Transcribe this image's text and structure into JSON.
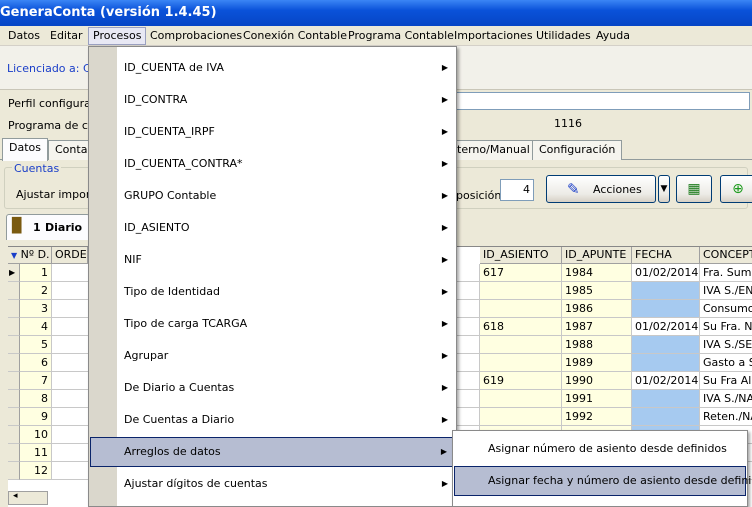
{
  "app": {
    "title": "GeneraConta (versión 1.4.45)"
  },
  "menubar": [
    "Datos",
    "Editar",
    "Procesos",
    "Comprobaciones",
    "Conexión Contable",
    "Programa Contable",
    "Importaciones",
    "Utilidades",
    "Ayuda"
  ],
  "license_text": "Licenciado a: CR",
  "form": {
    "perfil_label": "Perfil configurac",
    "programa_label": "Programa de cor",
    "value_1116": "1116"
  },
  "tabs": [
    "Datos",
    "Conta",
    "terno/Manual",
    "Configuración"
  ],
  "cuentas": {
    "group_label": "Cuentas",
    "ajustar_label": "Ajustar importa",
    "posicion_label": "posición",
    "posicion_value": "4",
    "acciones_label": "Acciones"
  },
  "diario_tab": {
    "num": "1",
    "label": "Diario"
  },
  "grid": {
    "columns": [
      "Nº D.",
      "ORDE",
      "ID_ASIENTO",
      "ID_APUNTE",
      "FECHA",
      "CONCEPT"
    ],
    "rows": [
      {
        "n": "1",
        "asiento": "617",
        "apunte": "1984",
        "fecha": "01/02/2014",
        "concepto": "Fra. Sumir"
      },
      {
        "n": "2",
        "asiento": "",
        "apunte": "1985",
        "fecha": "",
        "concepto": "IVA S./EN"
      },
      {
        "n": "3",
        "asiento": "",
        "apunte": "1986",
        "fecha": "",
        "concepto": "Consumo"
      },
      {
        "n": "4",
        "asiento": "618",
        "apunte": "1987",
        "fecha": "01/02/2014",
        "concepto": "Su Fra. Nº"
      },
      {
        "n": "5",
        "asiento": "",
        "apunte": "1988",
        "fecha": "",
        "concepto": "IVA S./SE"
      },
      {
        "n": "6",
        "asiento": "",
        "apunte": "1989",
        "fecha": "",
        "concepto": "Gasto a S"
      },
      {
        "n": "7",
        "asiento": "619",
        "apunte": "1990",
        "fecha": "01/02/2014",
        "concepto": "Su Fra Alc"
      },
      {
        "n": "8",
        "asiento": "",
        "apunte": "1991",
        "fecha": "",
        "concepto": "IVA S./NA"
      },
      {
        "n": "9",
        "asiento": "",
        "apunte": "1992",
        "fecha": "",
        "concepto": "Reten./NA"
      },
      {
        "n": "10",
        "asiento": "",
        "apunte": "",
        "fecha": "",
        "concepto": ""
      },
      {
        "n": "11",
        "asiento": "",
        "apunte": "",
        "fecha": "",
        "concepto": ""
      },
      {
        "n": "12",
        "asiento": "",
        "apunte": "",
        "fecha": "",
        "concepto": ""
      }
    ]
  },
  "menu": {
    "items": [
      "ID_CUENTA de IVA",
      "ID_CONTRA",
      "ID_CUENTA_IRPF",
      "ID_CUENTA_CONTRA*",
      "GRUPO Contable",
      "ID_ASIENTO",
      "NIF",
      "Tipo de Identidad",
      "Tipo de carga TCARGA",
      "Agrupar",
      "De Diario a Cuentas",
      "De Cuentas a Diario",
      "Arreglos de datos",
      "Ajustar dígitos de cuentas"
    ],
    "hovered": "Arreglos de datos"
  },
  "submenu": {
    "items": [
      "Asignar número de asiento desde definidos",
      "Asignar fecha y número de asiento desde definidos"
    ],
    "hovered": "Asignar fecha y número de asiento desde definidos"
  },
  "colors": {
    "titlebar": "#0a52d9",
    "menu_hover": "#b6bdd2",
    "cell_yellow": "#ffffe1",
    "cell_blue": "#a6caf0"
  }
}
